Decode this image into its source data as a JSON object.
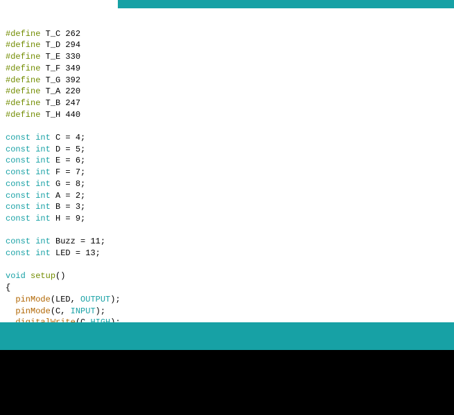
{
  "syntax": {
    "define": "#define",
    "const": "const",
    "int": "int",
    "void": "void",
    "setup": "setup",
    "pinMode": "pinMode",
    "digitalWrite": "digitalWrite",
    "OUTPUT": "OUTPUT",
    "INPUT": "INPUT",
    "HIGH": "HIGH"
  },
  "defines": [
    {
      "name": "T_C",
      "value": "262"
    },
    {
      "name": "T_D",
      "value": "294"
    },
    {
      "name": "T_E",
      "value": "330"
    },
    {
      "name": "T_F",
      "value": "349"
    },
    {
      "name": "T_G",
      "value": "392"
    },
    {
      "name": "T_A",
      "value": "220"
    },
    {
      "name": "T_B",
      "value": "247"
    },
    {
      "name": "T_H",
      "value": "440"
    }
  ],
  "consts_pins": [
    {
      "name": "C",
      "value": "4"
    },
    {
      "name": "D",
      "value": "5"
    },
    {
      "name": "E",
      "value": "6"
    },
    {
      "name": "F",
      "value": "7"
    },
    {
      "name": "G",
      "value": "8"
    },
    {
      "name": "A",
      "value": "2"
    },
    {
      "name": "B",
      "value": "3"
    },
    {
      "name": "H",
      "value": "9"
    }
  ],
  "consts_other": [
    {
      "name": "Buzz",
      "value": "11"
    },
    {
      "name": "LED",
      "value": "13"
    }
  ],
  "setup_lines": [
    {
      "fn": "pinMode",
      "arg1": "LED",
      "arg2": "OUTPUT",
      "sep": ", "
    },
    {
      "fn": "pinMode",
      "arg1": "C",
      "arg2": "INPUT",
      "sep": ", "
    },
    {
      "fn": "digitalWrite",
      "arg1": "C",
      "arg2": "HIGH",
      "sep": ","
    }
  ]
}
